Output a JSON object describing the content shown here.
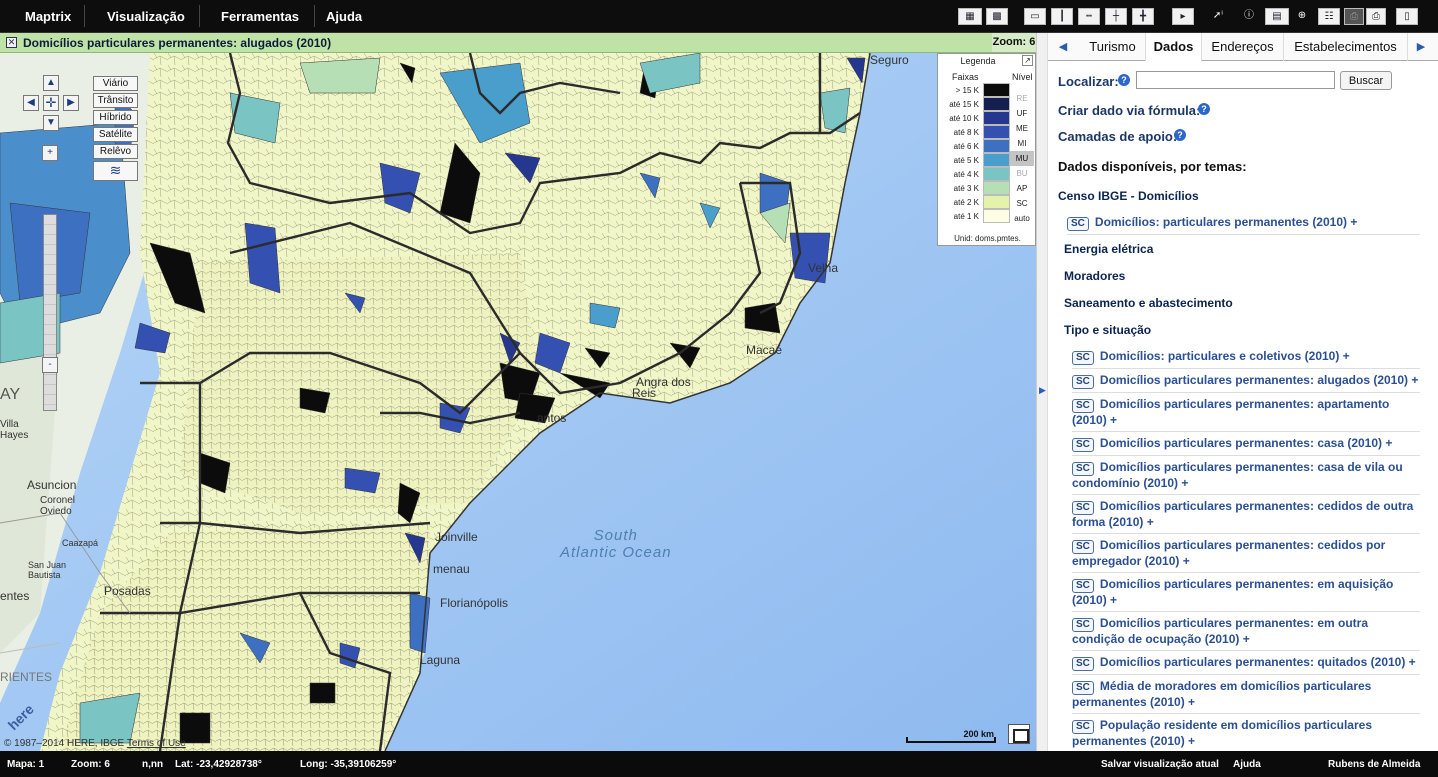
{
  "menubar": {
    "items": [
      "Maptrix",
      "Visualização",
      "Ferramentas",
      "Ajuda"
    ]
  },
  "toolbar": {
    "icons": [
      "layout-2x2-icon",
      "layout-grid-icon",
      "layout-single-icon",
      "layout-columns-icon",
      "layout-rows-icon",
      "layout-split-icon",
      "layout-quad-icon",
      "next-layout-icon",
      "pointer-info-icon",
      "info-icon",
      "ruler-icon",
      "zoom-tool-icon",
      "table-icon",
      "print-icon",
      "print-preview-icon",
      "export-icon"
    ]
  },
  "map_title": {
    "title": "Domicílios particulares permanentes: alugados (2010)",
    "zoom": "Zoom: 6"
  },
  "map_controls": {
    "pan_up": "▲",
    "pan_left": "◀",
    "pan_center": "✛",
    "pan_right": "▶",
    "pan_down": "▼",
    "zoom_in": "+",
    "zoom_out": "-",
    "layer_buttons": [
      "Viário",
      "Trânsito",
      "Híbrido",
      "Satélite",
      "Relêvo"
    ]
  },
  "legend": {
    "title": "Legenda",
    "faixas_label": "Faixas",
    "nivel_label": "Nível",
    "expand": "↗",
    "rows": [
      {
        "label": "> 15 K",
        "color": "#0c0c0c"
      },
      {
        "label": "até 15 K",
        "color": "#151f4f"
      },
      {
        "label": "até 10 K",
        "color": "#26378f"
      },
      {
        "label": "até 8 K",
        "color": "#3450b0"
      },
      {
        "label": "até 6 K",
        "color": "#3e70c1"
      },
      {
        "label": "até 5 K",
        "color": "#4a9ecc"
      },
      {
        "label": "até 4 K",
        "color": "#7bc4c4"
      },
      {
        "label": "até 3 K",
        "color": "#b7dfb5"
      },
      {
        "label": "até 2 K",
        "color": "#e4f2ab"
      },
      {
        "label": "até 1 K",
        "color": "#fcfde3"
      }
    ],
    "levels": [
      {
        "label": "RE",
        "state": "dim"
      },
      {
        "label": "UF",
        "state": "on"
      },
      {
        "label": "ME",
        "state": "on"
      },
      {
        "label": "MI",
        "state": "on"
      },
      {
        "label": "MU",
        "state": "selected"
      },
      {
        "label": "BU",
        "state": "dim"
      },
      {
        "label": "AP",
        "state": "on"
      },
      {
        "label": "SC",
        "state": "on"
      },
      {
        "label": "auto",
        "state": "on"
      }
    ],
    "unit": "Unid: doms.pmtes."
  },
  "map_labels": {
    "ocean_line1": "South",
    "ocean_line2": "Atlantic Ocean",
    "places": [
      "Seguro",
      "Velha",
      "Macaé",
      "Angra dos",
      "Reis",
      "antos",
      "Joinville",
      "menau",
      "Florianópolis",
      "Laguna",
      "Asuncion",
      "Coronel",
      "Oviedo",
      "Caazapá",
      "San Juan",
      "Bautista",
      "Posadas",
      "Villa",
      "Hayes",
      "AY",
      "entes",
      "RIENTES"
    ]
  },
  "scale": {
    "label": "200 km"
  },
  "copyright": {
    "text": "© 1987–2014 HERE, IBGE",
    "terms": "Terms of Use",
    "brand": "here"
  },
  "panel": {
    "tabs": [
      "Turismo",
      "Dados",
      "Endereços",
      "Estabelecimentos"
    ],
    "active_tab": "Dados",
    "tab_prev": "◀",
    "tab_next": "▶",
    "localizar_label": "Localizar:",
    "search_placeholder": "",
    "search_button": "Buscar",
    "criar_label": "Criar dado via fórmula:",
    "camadas_label": "Camadas de apoio:",
    "disponiveis_label": "Dados disponíveis, por temas:",
    "group_title": "Censo IBGE - Domicílios",
    "top_item": "Domicílios: particulares permanentes (2010) +",
    "categories": [
      "Energia elétrica",
      "Moradores",
      "Saneamento e abastecimento",
      "Tipo e situação"
    ],
    "sc_badge": "SC",
    "items": [
      "Domicílios: particulares e coletivos (2010) +",
      "Domicílios particulares permanentes: alugados (2010) +",
      "Domicílios particulares permanentes: apartamento (2010) +",
      "Domicílios particulares permanentes: casa (2010) +",
      "Domicílios particulares permanentes: casa de vila ou condomínio (2010) +",
      "Domicílios particulares permanentes: cedidos de outra forma (2010) +",
      "Domicílios particulares permanentes: cedidos por empregador (2010) +",
      "Domicílios particulares permanentes: em aquisição (2010) +",
      "Domicílios particulares permanentes: em outra condição de ocupação (2010) +",
      "Domicílios particulares permanentes: quitados (2010) +",
      "Média de moradores em domicílios particulares permanentes (2010) +",
      "População residente em domicílios particulares permanentes (2010) +"
    ]
  },
  "statusbar": {
    "mapa": "Mapa: 1",
    "zoom": "Zoom: 6",
    "nn": "n,nn",
    "lat": "Lat: -23,42928738°",
    "long": "Long: -35,39106259°",
    "save": "Salvar visualização atual",
    "help": "Ajuda",
    "user": "Rubens de Almeida"
  }
}
